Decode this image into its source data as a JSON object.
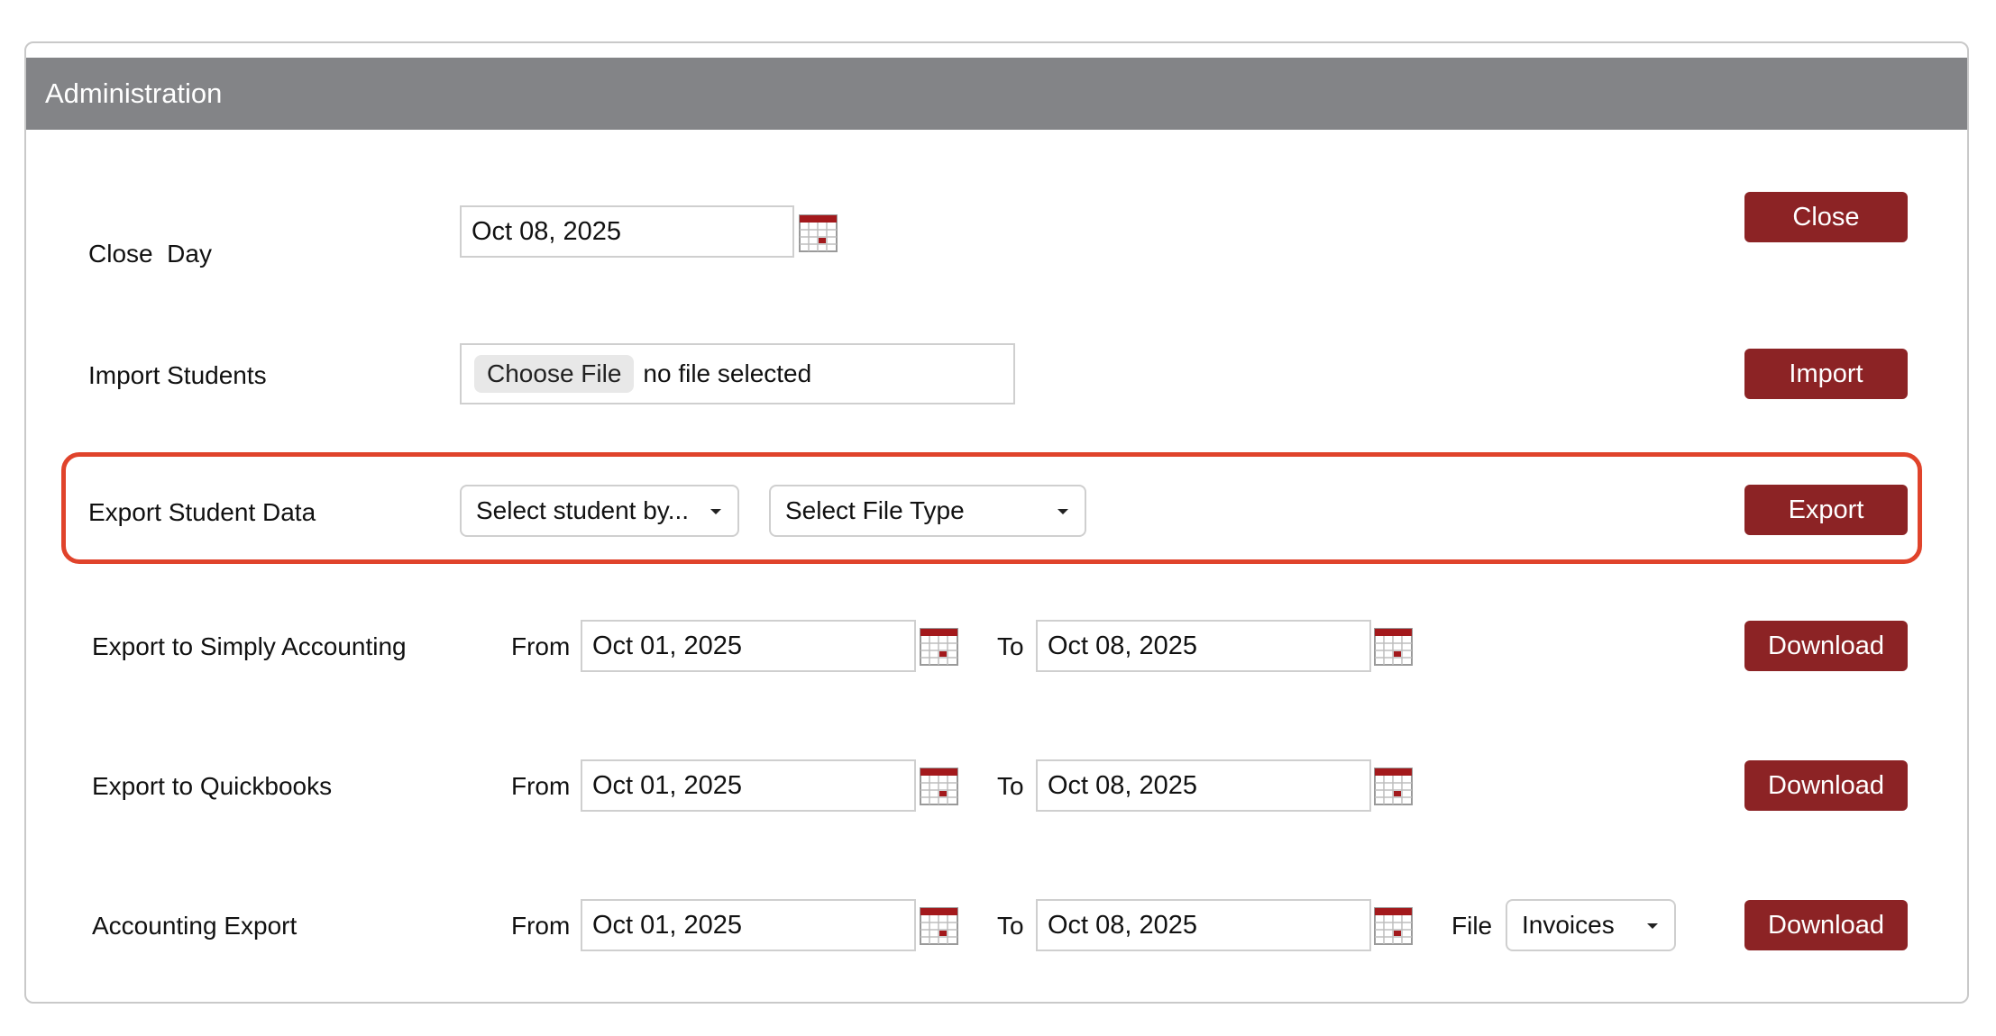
{
  "panel": {
    "title": "Administration"
  },
  "close_day": {
    "label": "Close  Day",
    "date": "Oct 08, 2025",
    "button": "Close"
  },
  "import_students": {
    "label": "Import Students",
    "choose_label": "Choose File",
    "file_status": "no file selected",
    "button": "Import"
  },
  "export_student_data": {
    "label": "Export Student Data",
    "select_student": "Select student by...",
    "select_file_type": "Select File Type",
    "button": "Export"
  },
  "export_simply": {
    "label": "Export to Simply Accounting",
    "from_label": "From",
    "from_date": "Oct 01, 2025",
    "to_label": "To",
    "to_date": "Oct 08, 2025",
    "button": "Download"
  },
  "export_quickbooks": {
    "label": "Export to Quickbooks",
    "from_label": "From",
    "from_date": "Oct 01, 2025",
    "to_label": "To",
    "to_date": "Oct 08, 2025",
    "button": "Download"
  },
  "accounting_export": {
    "label": "Accounting Export",
    "from_label": "From",
    "from_date": "Oct 01, 2025",
    "to_label": "To",
    "to_date": "Oct 08, 2025",
    "file_label": "File",
    "file_value": "Invoices",
    "button": "Download"
  },
  "colors": {
    "header_bg": "#838487",
    "button_bg": "#8c2325",
    "highlight": "#e0432b",
    "calendar_red": "#a3191c"
  },
  "icons": {
    "calendar": "calendar-icon",
    "dropdown": "caret-down-icon"
  }
}
